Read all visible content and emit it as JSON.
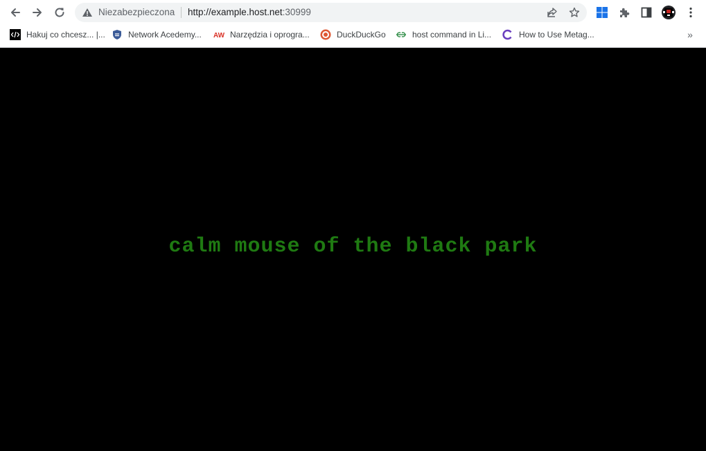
{
  "toolbar": {
    "back_icon": "back-arrow-icon",
    "forward_icon": "forward-arrow-icon",
    "reload_icon": "reload-icon",
    "omnibox": {
      "security_label": "Niezabezpieczona",
      "url_main": "http://example.host.net",
      "url_port": ":30999"
    },
    "share_icon": "share-icon",
    "bookmark_star_icon": "star-icon",
    "extensions": [
      "windows-logo-icon",
      "puzzle-icon",
      "side-panel-icon",
      "profile-avatar-icon",
      "kebab-menu-icon"
    ]
  },
  "bookmarks": [
    {
      "label": "Hakuj co chcesz... |...",
      "icon": "code-tag-icon"
    },
    {
      "label": "Network Acedemy...",
      "icon": "shield-badge-icon"
    },
    {
      "label": "Narzędzia i oprogra...",
      "icon": "aw-logo-icon"
    },
    {
      "label": "DuckDuckGo",
      "icon": "duckduckgo-icon"
    },
    {
      "label": "host command in Li...",
      "icon": "geeksforgeeks-icon"
    },
    {
      "label": "How to Use Metag...",
      "icon": "c-logo-icon"
    }
  ],
  "page": {
    "phrase": "calm mouse of the black park",
    "phrase_color": "#1f7a12",
    "background": "#000000"
  }
}
